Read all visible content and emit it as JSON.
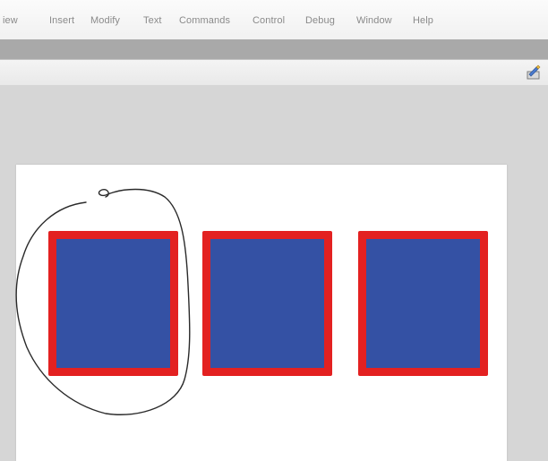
{
  "menubar": {
    "items": [
      "iew",
      "Insert",
      "Modify",
      "Text",
      "Commands",
      "Control",
      "Debug",
      "Window",
      "Help"
    ]
  },
  "toolbar": {
    "icon": "edit-icon"
  },
  "stage": {
    "background": "#ffffff",
    "symbols": [
      {
        "fill": "#3451a4",
        "stroke": "#e32121",
        "annotated": true
      },
      {
        "fill": "#3451a4",
        "stroke": "#e32121",
        "annotated": false
      },
      {
        "fill": "#3451a4",
        "stroke": "#e32121",
        "annotated": false
      }
    ]
  },
  "annotation": {
    "type": "hand-drawn circle",
    "color": "#2a2a2a"
  }
}
